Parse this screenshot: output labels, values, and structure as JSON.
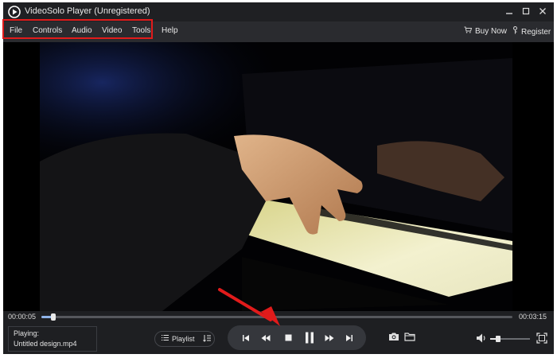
{
  "window": {
    "title": "VideoSolo Player (Unregistered)",
    "controls": [
      "minimize-icon",
      "maximize-icon",
      "close-icon"
    ]
  },
  "menu": {
    "items": [
      "File",
      "Controls",
      "Audio",
      "Video",
      "Tools",
      "Help"
    ],
    "buy_now": "Buy Now",
    "register": "Register"
  },
  "playback": {
    "elapsed": "00:00:05",
    "duration": "00:03:15",
    "progress_fraction": 0.026,
    "volume_fraction": 0.2
  },
  "now_playing": {
    "label": "Playing:",
    "file": "Untitled design.mp4"
  },
  "playlist": {
    "label": "Playlist"
  },
  "transport": [
    "previous-icon",
    "rewind-icon",
    "stop-icon",
    "pause-icon",
    "fast-forward-icon",
    "next-icon"
  ],
  "tools": [
    "camera-icon",
    "folder-icon",
    "volume-icon",
    "fullscreen-icon"
  ],
  "colors": {
    "background": "#1e1f22",
    "highlight": "#e11b1b",
    "accent": "#8fb3e8"
  }
}
